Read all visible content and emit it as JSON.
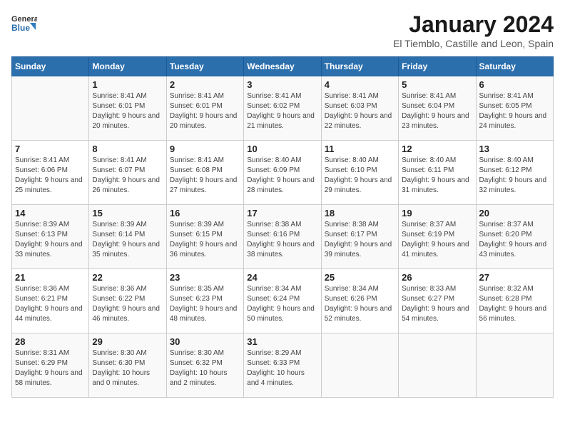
{
  "header": {
    "logo_line1": "General",
    "logo_line2": "Blue",
    "month": "January 2024",
    "location": "El Tiemblo, Castille and Leon, Spain"
  },
  "weekdays": [
    "Sunday",
    "Monday",
    "Tuesday",
    "Wednesday",
    "Thursday",
    "Friday",
    "Saturday"
  ],
  "weeks": [
    [
      {
        "day": "",
        "sunrise": "",
        "sunset": "",
        "daylight": ""
      },
      {
        "day": "1",
        "sunrise": "Sunrise: 8:41 AM",
        "sunset": "Sunset: 6:01 PM",
        "daylight": "Daylight: 9 hours and 20 minutes."
      },
      {
        "day": "2",
        "sunrise": "Sunrise: 8:41 AM",
        "sunset": "Sunset: 6:01 PM",
        "daylight": "Daylight: 9 hours and 20 minutes."
      },
      {
        "day": "3",
        "sunrise": "Sunrise: 8:41 AM",
        "sunset": "Sunset: 6:02 PM",
        "daylight": "Daylight: 9 hours and 21 minutes."
      },
      {
        "day": "4",
        "sunrise": "Sunrise: 8:41 AM",
        "sunset": "Sunset: 6:03 PM",
        "daylight": "Daylight: 9 hours and 22 minutes."
      },
      {
        "day": "5",
        "sunrise": "Sunrise: 8:41 AM",
        "sunset": "Sunset: 6:04 PM",
        "daylight": "Daylight: 9 hours and 23 minutes."
      },
      {
        "day": "6",
        "sunrise": "Sunrise: 8:41 AM",
        "sunset": "Sunset: 6:05 PM",
        "daylight": "Daylight: 9 hours and 24 minutes."
      }
    ],
    [
      {
        "day": "7",
        "sunrise": "Sunrise: 8:41 AM",
        "sunset": "Sunset: 6:06 PM",
        "daylight": "Daylight: 9 hours and 25 minutes."
      },
      {
        "day": "8",
        "sunrise": "Sunrise: 8:41 AM",
        "sunset": "Sunset: 6:07 PM",
        "daylight": "Daylight: 9 hours and 26 minutes."
      },
      {
        "day": "9",
        "sunrise": "Sunrise: 8:41 AM",
        "sunset": "Sunset: 6:08 PM",
        "daylight": "Daylight: 9 hours and 27 minutes."
      },
      {
        "day": "10",
        "sunrise": "Sunrise: 8:40 AM",
        "sunset": "Sunset: 6:09 PM",
        "daylight": "Daylight: 9 hours and 28 minutes."
      },
      {
        "day": "11",
        "sunrise": "Sunrise: 8:40 AM",
        "sunset": "Sunset: 6:10 PM",
        "daylight": "Daylight: 9 hours and 29 minutes."
      },
      {
        "day": "12",
        "sunrise": "Sunrise: 8:40 AM",
        "sunset": "Sunset: 6:11 PM",
        "daylight": "Daylight: 9 hours and 31 minutes."
      },
      {
        "day": "13",
        "sunrise": "Sunrise: 8:40 AM",
        "sunset": "Sunset: 6:12 PM",
        "daylight": "Daylight: 9 hours and 32 minutes."
      }
    ],
    [
      {
        "day": "14",
        "sunrise": "Sunrise: 8:39 AM",
        "sunset": "Sunset: 6:13 PM",
        "daylight": "Daylight: 9 hours and 33 minutes."
      },
      {
        "day": "15",
        "sunrise": "Sunrise: 8:39 AM",
        "sunset": "Sunset: 6:14 PM",
        "daylight": "Daylight: 9 hours and 35 minutes."
      },
      {
        "day": "16",
        "sunrise": "Sunrise: 8:39 AM",
        "sunset": "Sunset: 6:15 PM",
        "daylight": "Daylight: 9 hours and 36 minutes."
      },
      {
        "day": "17",
        "sunrise": "Sunrise: 8:38 AM",
        "sunset": "Sunset: 6:16 PM",
        "daylight": "Daylight: 9 hours and 38 minutes."
      },
      {
        "day": "18",
        "sunrise": "Sunrise: 8:38 AM",
        "sunset": "Sunset: 6:17 PM",
        "daylight": "Daylight: 9 hours and 39 minutes."
      },
      {
        "day": "19",
        "sunrise": "Sunrise: 8:37 AM",
        "sunset": "Sunset: 6:19 PM",
        "daylight": "Daylight: 9 hours and 41 minutes."
      },
      {
        "day": "20",
        "sunrise": "Sunrise: 8:37 AM",
        "sunset": "Sunset: 6:20 PM",
        "daylight": "Daylight: 9 hours and 43 minutes."
      }
    ],
    [
      {
        "day": "21",
        "sunrise": "Sunrise: 8:36 AM",
        "sunset": "Sunset: 6:21 PM",
        "daylight": "Daylight: 9 hours and 44 minutes."
      },
      {
        "day": "22",
        "sunrise": "Sunrise: 8:36 AM",
        "sunset": "Sunset: 6:22 PM",
        "daylight": "Daylight: 9 hours and 46 minutes."
      },
      {
        "day": "23",
        "sunrise": "Sunrise: 8:35 AM",
        "sunset": "Sunset: 6:23 PM",
        "daylight": "Daylight: 9 hours and 48 minutes."
      },
      {
        "day": "24",
        "sunrise": "Sunrise: 8:34 AM",
        "sunset": "Sunset: 6:24 PM",
        "daylight": "Daylight: 9 hours and 50 minutes."
      },
      {
        "day": "25",
        "sunrise": "Sunrise: 8:34 AM",
        "sunset": "Sunset: 6:26 PM",
        "daylight": "Daylight: 9 hours and 52 minutes."
      },
      {
        "day": "26",
        "sunrise": "Sunrise: 8:33 AM",
        "sunset": "Sunset: 6:27 PM",
        "daylight": "Daylight: 9 hours and 54 minutes."
      },
      {
        "day": "27",
        "sunrise": "Sunrise: 8:32 AM",
        "sunset": "Sunset: 6:28 PM",
        "daylight": "Daylight: 9 hours and 56 minutes."
      }
    ],
    [
      {
        "day": "28",
        "sunrise": "Sunrise: 8:31 AM",
        "sunset": "Sunset: 6:29 PM",
        "daylight": "Daylight: 9 hours and 58 minutes."
      },
      {
        "day": "29",
        "sunrise": "Sunrise: 8:30 AM",
        "sunset": "Sunset: 6:30 PM",
        "daylight": "Daylight: 10 hours and 0 minutes."
      },
      {
        "day": "30",
        "sunrise": "Sunrise: 8:30 AM",
        "sunset": "Sunset: 6:32 PM",
        "daylight": "Daylight: 10 hours and 2 minutes."
      },
      {
        "day": "31",
        "sunrise": "Sunrise: 8:29 AM",
        "sunset": "Sunset: 6:33 PM",
        "daylight": "Daylight: 10 hours and 4 minutes."
      },
      {
        "day": "",
        "sunrise": "",
        "sunset": "",
        "daylight": ""
      },
      {
        "day": "",
        "sunrise": "",
        "sunset": "",
        "daylight": ""
      },
      {
        "day": "",
        "sunrise": "",
        "sunset": "",
        "daylight": ""
      }
    ]
  ]
}
